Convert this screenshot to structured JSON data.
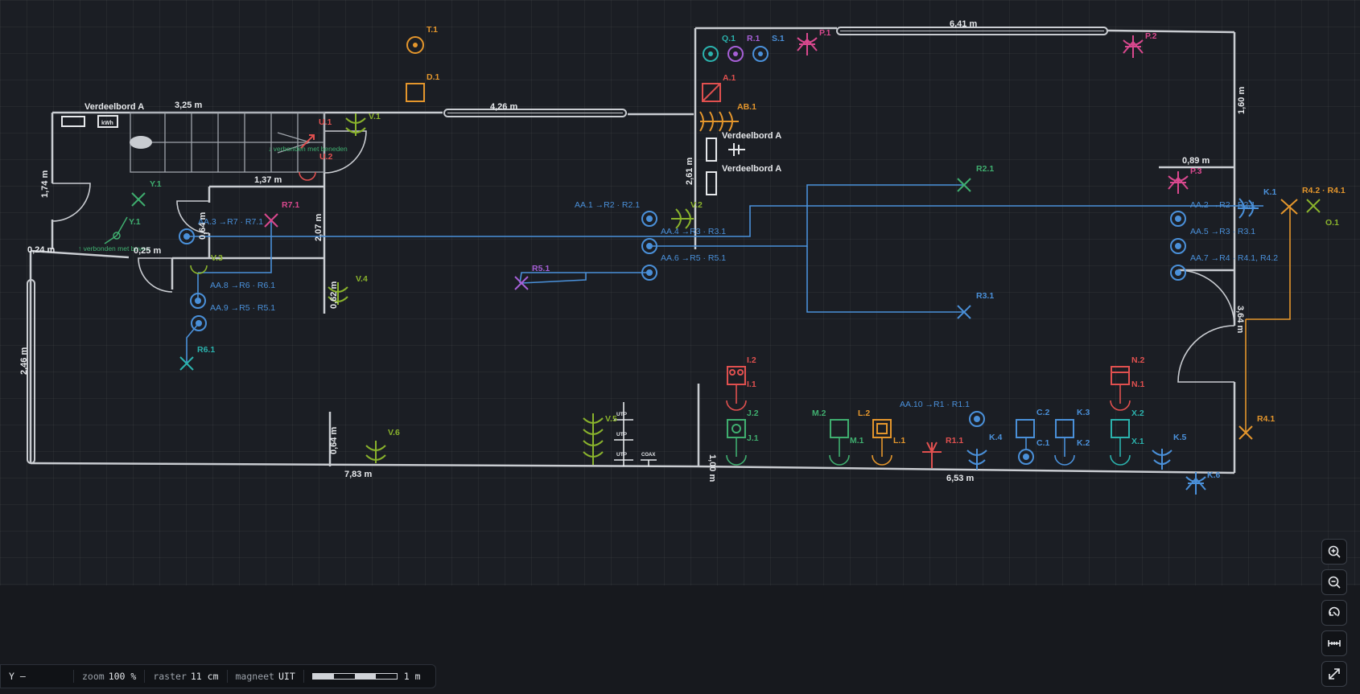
{
  "canvas": {
    "background": "#1b1e24",
    "colors": {
      "wall": "#c9ccd1",
      "blue": "#4a90d9",
      "green": "#3fae6f",
      "orange": "#e4962c",
      "red": "#e0504f",
      "olive": "#8ab32c",
      "pink": "#d9488e",
      "teal": "#2bb2ad",
      "purple": "#a65fd6"
    }
  },
  "labels": {
    "T1": "T.1",
    "D1": "D.1",
    "Q1": "Q.1",
    "R1": "R.1",
    "S1": "S.1",
    "P1": "P.1",
    "P2": "P.2",
    "P3": "P.3",
    "A1": "A.1",
    "AB1": "AB.1",
    "V1": "V.1",
    "V2": "V.2",
    "V3": "V.3",
    "V4": "V.4",
    "V5": "V.5",
    "V6": "V.6",
    "U1": "U.1",
    "U2": "U.2",
    "Y1a": "Y.1",
    "Y1b": "Y.1",
    "R71": "R7.1",
    "R21": "R2.1",
    "R31": "R3.1",
    "R51": "R5.1",
    "R61": "R6.1",
    "K1": "K.1",
    "K2": "K.2",
    "K3": "K.3",
    "K4": "K.4",
    "K5": "K.5",
    "K6": "K.6",
    "R42R41": "R4.2 · R4.1",
    "O1": "O.1",
    "R41": "R4.1",
    "I2": "I.2",
    "I1": "I.1",
    "J2": "J.2",
    "J1": "J.1",
    "M2": "M.2",
    "M1": "M.1",
    "L2": "L.2",
    "L1": "L.1",
    "R11": "R1.1",
    "C2": "C.2",
    "C1": "C.1",
    "N2": "N.2",
    "N1": "N.1",
    "X2": "X.2",
    "X1": "X.1",
    "verdeelbord1": "Verdeelbord A",
    "verdeelbord2": "Verdeelbord A",
    "verdeelbord3": "Verdeelbord A",
    "kwh": "kWh",
    "utp1": "UTP",
    "utp2": "UTP",
    "utp3": "UTP",
    "coax": "COAX",
    "beneden": "↓ verbonden met beneden",
    "boven": "↑ verbonden met boven",
    "AA1": "AA.1 →R2 · R2.1",
    "AA2": "AA.2 →R2 · R2.1",
    "AA3": "AA.3 →R7 · R7.1",
    "AA4": "AA.4 →R3 · R3.1",
    "AA5": "AA.5 →R3 · R3.1",
    "AA6": "AA.6 →R5 · R5.1",
    "AA7": "AA.7 →R4 · R4.1, R4.2",
    "AA8": "AA.8 →R6 · R6.1",
    "AA9": "AA.9 →R5 · R5.1",
    "AA10": "AA.10 →R1 · R1.1"
  },
  "dimensions": {
    "d325": "3,25 m",
    "d426": "4,26 m",
    "d641": "6,41 m",
    "d160": "1,60 m",
    "d089": "0,89 m",
    "d137": "1,37 m",
    "d174": "1,74 m",
    "d024": "0,24 m",
    "d025": "0,25 m",
    "d246": "2,46 m",
    "d207": "2,07 m",
    "d261": "2,61 m",
    "d064a": "0,64 m",
    "d064b": "0,64 m",
    "d062": "0,62 m",
    "d100": "1,00 m",
    "d783": "7,83 m",
    "d653": "6,53 m",
    "d364": "3,64 m"
  },
  "toolbar": {
    "zoom_in": "zoom-in",
    "zoom_out": "zoom-out",
    "rotate": "rotate",
    "measure": "measure",
    "fit": "fit-screen"
  },
  "status": {
    "axis": "Y –",
    "zoom_label": "zoom",
    "zoom_value": "100 %",
    "raster_label": "raster",
    "raster_value": "11 cm",
    "magneet_label": "magneet",
    "magneet_value": "UIT",
    "scale_value": "1 m"
  }
}
